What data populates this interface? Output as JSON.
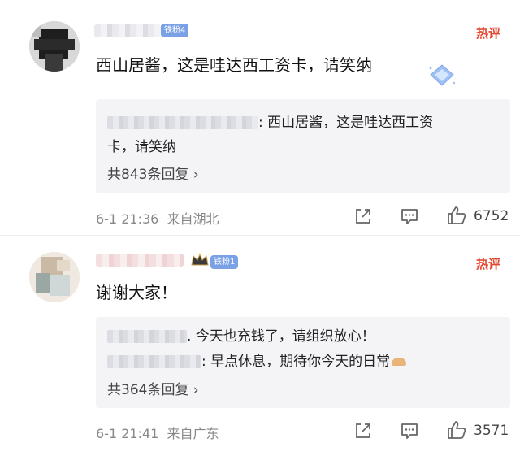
{
  "comments": [
    {
      "badge": "铁粉4",
      "hot": "热评",
      "text": "西山居酱，这是哇达西工资卡，请笑纳",
      "replies": [
        {
          "line1": ": 西山居酱，这是哇达西工资",
          "line2": "卡，请笑纳"
        }
      ],
      "more": "共843条回复 ›",
      "time": "6-1 21:36",
      "location": "来自湖北",
      "likes": "6752"
    },
    {
      "badge": "铁粉1",
      "hot": "热评",
      "text": "谢谢大家！",
      "replies": [
        {
          "line1": ". 今天也充钱了，请组织放心！"
        },
        {
          "line1": ": 早点休息，期待你今天的日常"
        }
      ],
      "more": "共364条回复 ›",
      "time": "6-1 21:41",
      "location": "来自广东",
      "likes": "3571"
    }
  ],
  "colors": {
    "hot": "#e2462f",
    "badge": "#7aa1e6",
    "reply_bg": "#f4f4f7",
    "meta": "#888888"
  },
  "icons": [
    "share-icon",
    "comment-icon",
    "like-icon",
    "diamond-icon",
    "crown-icon"
  ]
}
